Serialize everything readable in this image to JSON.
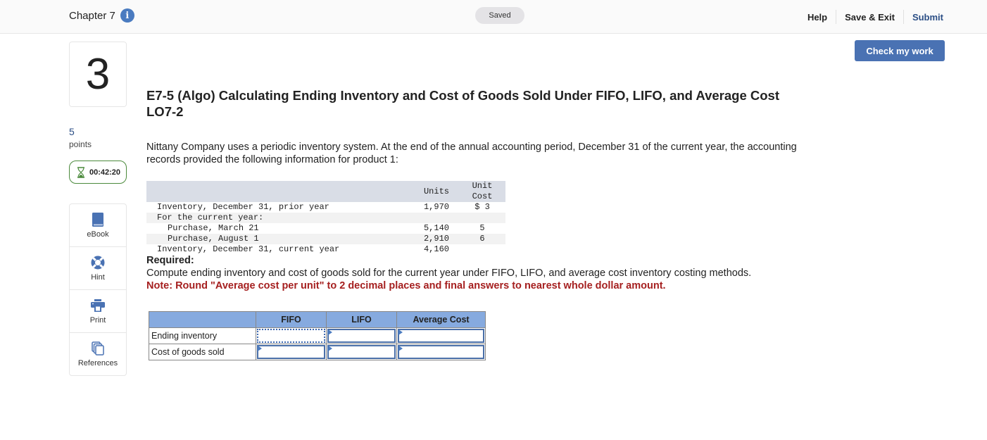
{
  "header": {
    "chapter": "Chapter 7",
    "info_icon": "info-icon",
    "status": "Saved",
    "links": {
      "help": "Help",
      "save_exit": "Save & Exit",
      "submit": "Submit"
    },
    "check_button": "Check my work"
  },
  "sidebar": {
    "question_number": "3",
    "points_value": "5",
    "points_label": "points",
    "timer": "00:42:20",
    "timer_icon": "hourglass-icon",
    "tools": [
      {
        "label": "eBook",
        "icon": "book-icon"
      },
      {
        "label": "Hint",
        "icon": "lifebuoy-icon"
      },
      {
        "label": "Print",
        "icon": "printer-icon"
      },
      {
        "label": "References",
        "icon": "documents-icon"
      }
    ]
  },
  "question": {
    "title": "E7-5 (Algo) Calculating Ending Inventory and Cost of Goods Sold Under FIFO, LIFO, and Average Cost LO7-2",
    "intro": "Nittany Company uses a periodic inventory system. At the end of the annual accounting period, December 31 of the current year, the accounting records provided the following information for product 1:",
    "inventory_table": {
      "headers": {
        "units": "Units",
        "unit_cost_line1": "Unit",
        "unit_cost_line2": "Cost"
      },
      "rows": [
        {
          "label": "Inventory, December 31, prior year",
          "units": "1,970",
          "cost": "$ 3"
        },
        {
          "label": "For the current year:",
          "units": "",
          "cost": ""
        },
        {
          "label": "Purchase, March 21",
          "units": "5,140",
          "cost": "5"
        },
        {
          "label": "Purchase, August 1",
          "units": "2,910",
          "cost": "6"
        },
        {
          "label": "Inventory, December 31, current year",
          "units": "4,160",
          "cost": ""
        }
      ]
    },
    "required_heading": "Required:",
    "required_text": "Compute ending inventory and cost of goods sold for the current year under FIFO, LIFO, and average cost inventory costing methods.",
    "note": "Note: Round \"Average cost per unit\" to 2 decimal places and final answers to nearest whole dollar amount."
  },
  "answer_table": {
    "columns": [
      "FIFO",
      "LIFO",
      "Average Cost"
    ],
    "rows": [
      {
        "label": "Ending inventory",
        "values": [
          "",
          "",
          ""
        ]
      },
      {
        "label": "Cost of goods sold",
        "values": [
          "",
          "",
          ""
        ]
      }
    ]
  }
}
